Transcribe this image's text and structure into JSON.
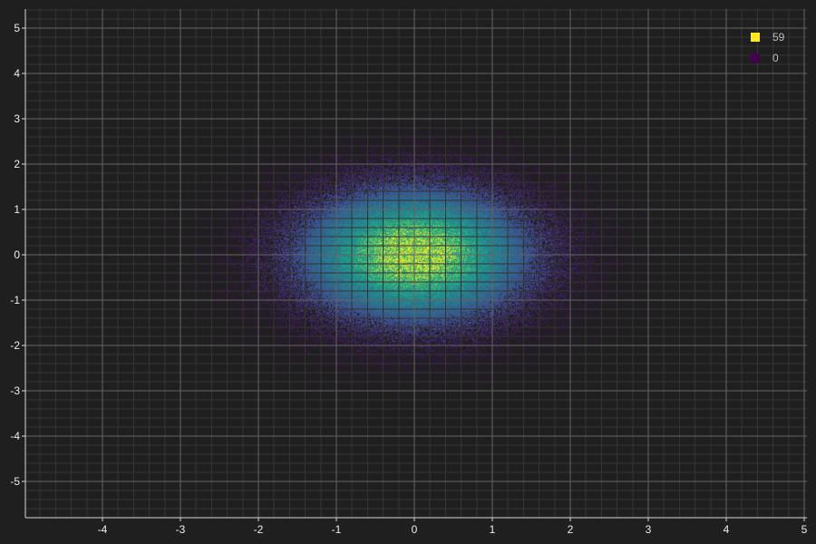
{
  "chart_data": {
    "type": "heatmap",
    "title": "",
    "xlabel": "",
    "ylabel": "",
    "xlim": [
      -5,
      5
    ],
    "ylim": [
      -5.8,
      5.4
    ],
    "x_ticks": [
      -4,
      -3,
      -2,
      -1,
      0,
      1,
      2,
      3,
      4,
      5
    ],
    "y_ticks": [
      -5,
      -4,
      -3,
      -2,
      -1,
      0,
      1,
      2,
      3,
      4,
      5
    ],
    "grid": true,
    "colormap": "viridis",
    "distribution": {
      "center_x": 0,
      "center_y": 0,
      "sigma_x": 1,
      "sigma_y": 1,
      "extent_x": [
        -3.6,
        3.6
      ],
      "extent_y": [
        -3.3,
        3.2
      ]
    },
    "legend": {
      "position": "top-right",
      "entries": [
        {
          "label": "59",
          "value": 59,
          "color": "#fde725"
        },
        {
          "label": "0",
          "value": 0,
          "color": "#440154"
        }
      ]
    },
    "colors": {
      "background": "#1f1f1f",
      "grid_major": "#646464",
      "grid_minor": "#343434",
      "axis": "#d8d8d8"
    }
  }
}
